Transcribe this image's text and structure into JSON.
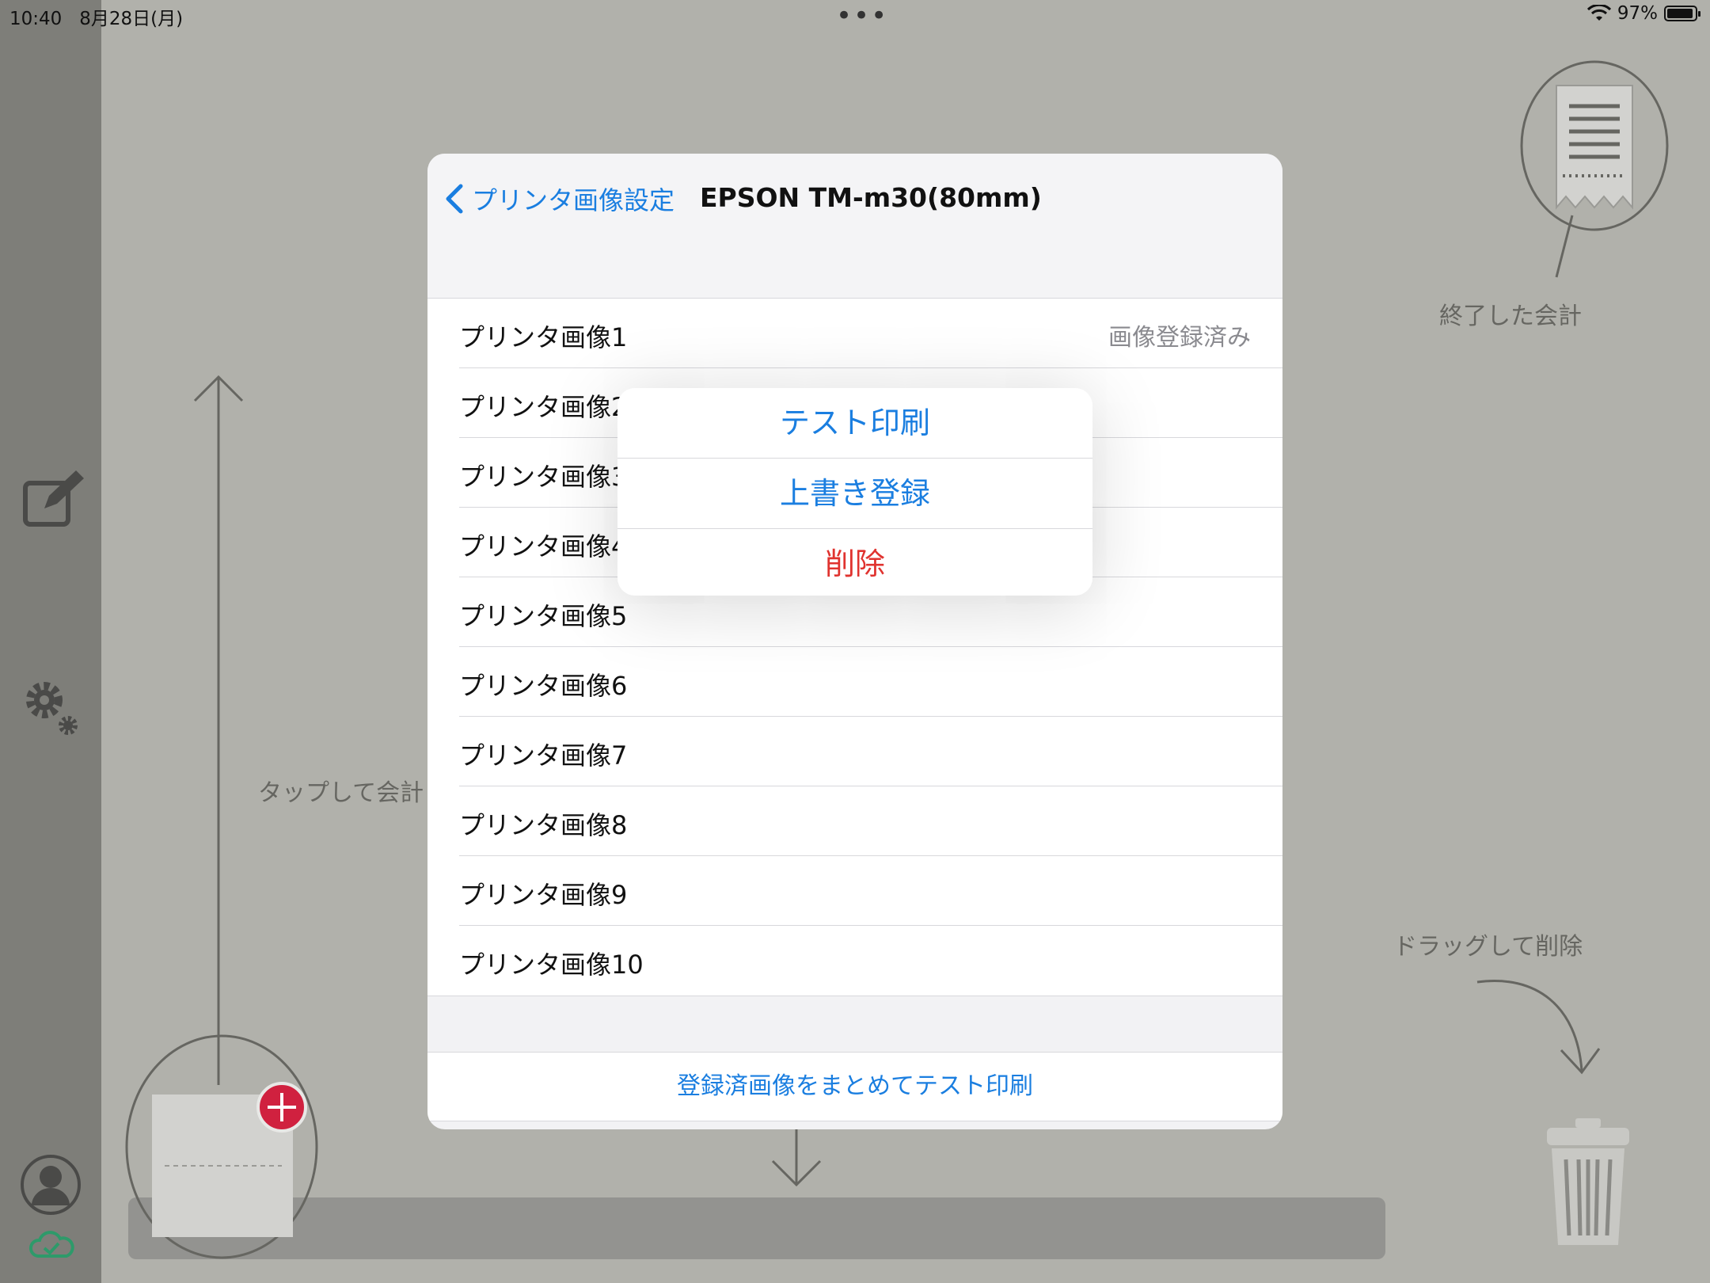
{
  "status_bar": {
    "time": "10:40",
    "date": "8月28日(月)",
    "dots": "•••",
    "battery": "97%"
  },
  "background": {
    "finished_label": "終了した会計",
    "tap_label": "タップして会計",
    "drag_label": "ドラッグして削除"
  },
  "modal": {
    "back_label": "プリンタ画像設定",
    "title": "EPSON TM-m30(80mm)",
    "rows": [
      {
        "label": "プリンタ画像1",
        "detail": "画像登録済み"
      },
      {
        "label": "プリンタ画像2",
        "detail": ""
      },
      {
        "label": "プリンタ画像3",
        "detail": ""
      },
      {
        "label": "プリンタ画像4",
        "detail": ""
      },
      {
        "label": "プリンタ画像5",
        "detail": ""
      },
      {
        "label": "プリンタ画像6",
        "detail": ""
      },
      {
        "label": "プリンタ画像7",
        "detail": ""
      },
      {
        "label": "プリンタ画像8",
        "detail": ""
      },
      {
        "label": "プリンタ画像9",
        "detail": ""
      },
      {
        "label": "プリンタ画像10",
        "detail": ""
      }
    ],
    "footer_button": "登録済画像をまとめてテスト印刷"
  },
  "popover": {
    "test_print": "テスト印刷",
    "overwrite": "上書き登録",
    "delete": "削除"
  },
  "colors": {
    "accent": "#1a7ee0",
    "destructive": "#e0332f",
    "add_badge": "#d0213f"
  }
}
